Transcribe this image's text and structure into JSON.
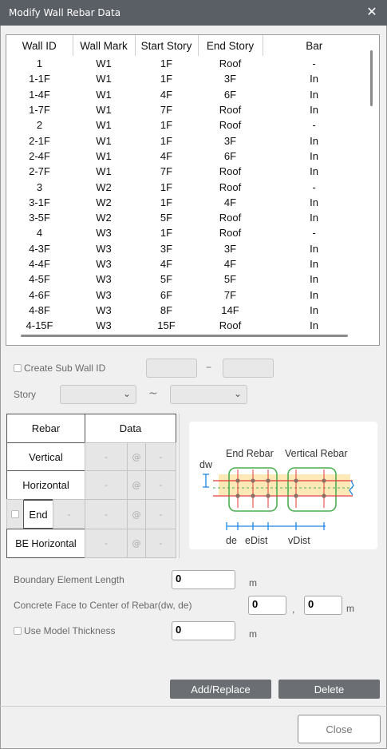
{
  "window": {
    "title": "Modify Wall Rebar Data",
    "close_glyph": "✕"
  },
  "table": {
    "columns": [
      "Wall ID",
      "Wall Mark",
      "Start Story",
      "End Story",
      "Bar"
    ],
    "rows": [
      [
        "1",
        "W1",
        "1F",
        "Roof",
        "-"
      ],
      [
        "1-1F",
        "W1",
        "1F",
        "3F",
        "In"
      ],
      [
        "1-4F",
        "W1",
        "4F",
        "6F",
        "In"
      ],
      [
        "1-7F",
        "W1",
        "7F",
        "Roof",
        "In"
      ],
      [
        "2",
        "W1",
        "1F",
        "Roof",
        "-"
      ],
      [
        "2-1F",
        "W1",
        "1F",
        "3F",
        "In"
      ],
      [
        "2-4F",
        "W1",
        "4F",
        "6F",
        "In"
      ],
      [
        "2-7F",
        "W1",
        "7F",
        "Roof",
        "In"
      ],
      [
        "3",
        "W2",
        "1F",
        "Roof",
        "-"
      ],
      [
        "3-1F",
        "W2",
        "1F",
        "4F",
        "In"
      ],
      [
        "3-5F",
        "W2",
        "5F",
        "Roof",
        "In"
      ],
      [
        "4",
        "W3",
        "1F",
        "Roof",
        "-"
      ],
      [
        "4-3F",
        "W3",
        "3F",
        "3F",
        "In"
      ],
      [
        "4-4F",
        "W3",
        "4F",
        "4F",
        "In"
      ],
      [
        "4-5F",
        "W3",
        "5F",
        "5F",
        "In"
      ],
      [
        "4-6F",
        "W3",
        "6F",
        "7F",
        "In"
      ],
      [
        "4-8F",
        "W3",
        "8F",
        "14F",
        "In"
      ],
      [
        "4-15F",
        "W3",
        "15F",
        "Roof",
        "In"
      ]
    ]
  },
  "sub_wall": {
    "label": "Create Sub Wall ID",
    "separator": "–"
  },
  "story": {
    "label": "Story",
    "separator": "~"
  },
  "rebar": {
    "header_rebar": "Rebar",
    "header_data": "Data",
    "rows": [
      {
        "name": "Vertical",
        "a": "-",
        "at": "@",
        "b": "-"
      },
      {
        "name": "Horizontal",
        "a": "-",
        "at": "@",
        "b": "-"
      },
      {
        "name": "End",
        "pre": "-",
        "a": "-",
        "at": "@",
        "b": "-"
      },
      {
        "name": "BE Horizontal",
        "a": "-",
        "at": "@",
        "b": "-"
      }
    ]
  },
  "diagram": {
    "end_rebar": "End Rebar",
    "vertical_rebar": "Vertical Rebar",
    "dw": "dw",
    "de": "de",
    "edist": "eDist",
    "vdist": "vDist"
  },
  "form": {
    "be_length_label": "Boundary Element Length",
    "be_length_value": "0",
    "be_length_unit": "m",
    "cover_label": "Concrete Face to Center of Rebar(dw, de)",
    "cover_dw_value": "0",
    "cover_comma": ",",
    "cover_de_value": "0",
    "cover_unit": "m",
    "model_thickness_label": "Use Model Thickness",
    "model_thickness_value": "0",
    "model_thickness_unit": "m"
  },
  "buttons": {
    "add_replace": "Add/Replace",
    "delete": "Delete",
    "close": "Close"
  },
  "colors": {
    "titlebar": "#5a5f66",
    "green": "#4caf50",
    "red": "#e53935",
    "blue": "#1e88e5",
    "band": "#fde9b8"
  }
}
